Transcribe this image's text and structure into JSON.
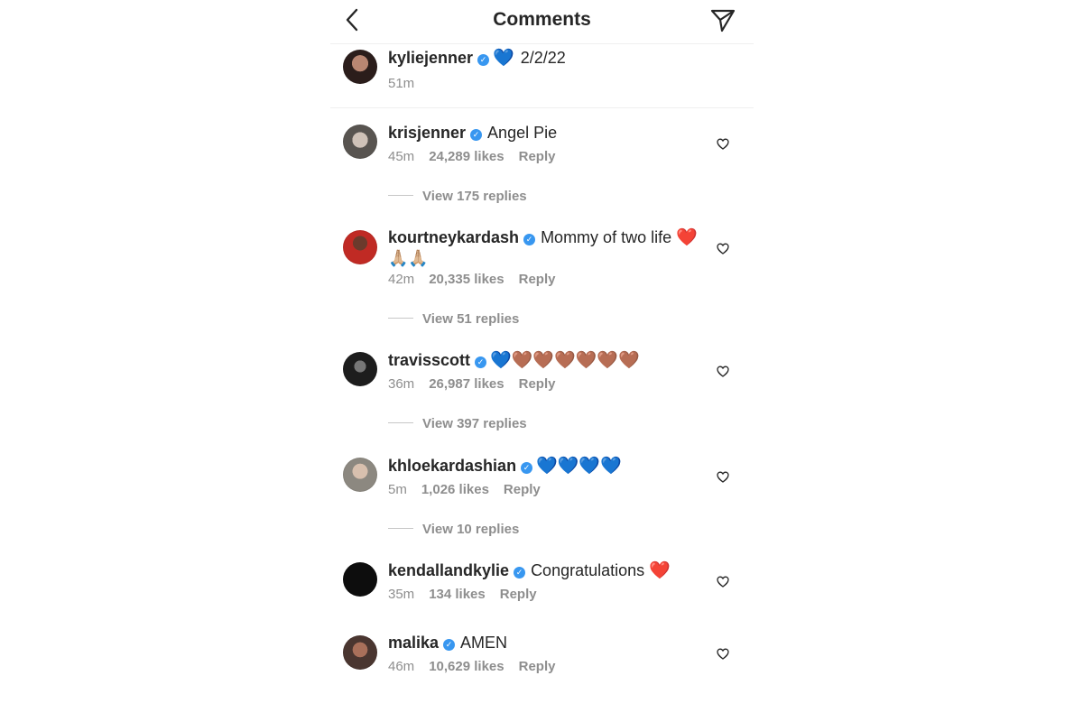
{
  "header": {
    "title": "Comments",
    "back_icon": "chevron-left-icon",
    "share_icon": "paper-plane-icon"
  },
  "caption": {
    "username": "kyliejenner",
    "verified": "✓",
    "emoji": "💙",
    "text": "2/2/22",
    "time": "51m"
  },
  "comments": [
    {
      "username": "krisjenner",
      "verified": "✓",
      "text": "Angel Pie",
      "time": "45m",
      "likes": "24,289 likes",
      "reply": "Reply",
      "view_replies": "View 175 replies"
    },
    {
      "username": "kourtneykardash",
      "verified": "✓",
      "text": "Mommy of two life",
      "emoji": "❤️",
      "emoji2": "🙏🏼🙏🏼",
      "time": "42m",
      "likes": "20,335 likes",
      "reply": "Reply",
      "view_replies": "View 51 replies"
    },
    {
      "username": "travisscott",
      "verified": "✓",
      "emoji_blue": "💙",
      "emoji_brown": "🤎🤎🤎🤎🤎🤎",
      "time": "36m",
      "likes": "26,987 likes",
      "reply": "Reply",
      "view_replies": "View 397 replies"
    },
    {
      "username": "khloekardashian",
      "verified": "✓",
      "emoji_blue": "💙💙💙💙",
      "time": "5m",
      "likes": "1,026 likes",
      "reply": "Reply",
      "view_replies": "View 10 replies"
    },
    {
      "username": "kendallandkylie",
      "verified": "✓",
      "text": "Congratulations",
      "emoji": "❤️",
      "time": "35m",
      "likes": "134 likes",
      "reply": "Reply"
    },
    {
      "username": "malika",
      "verified": "✓",
      "text": "AMEN",
      "time": "46m",
      "likes": "10,629 likes",
      "reply": "Reply"
    }
  ],
  "colors": {
    "verified": "#3897f0",
    "meta": "#8e8e8e",
    "text": "#262626"
  }
}
